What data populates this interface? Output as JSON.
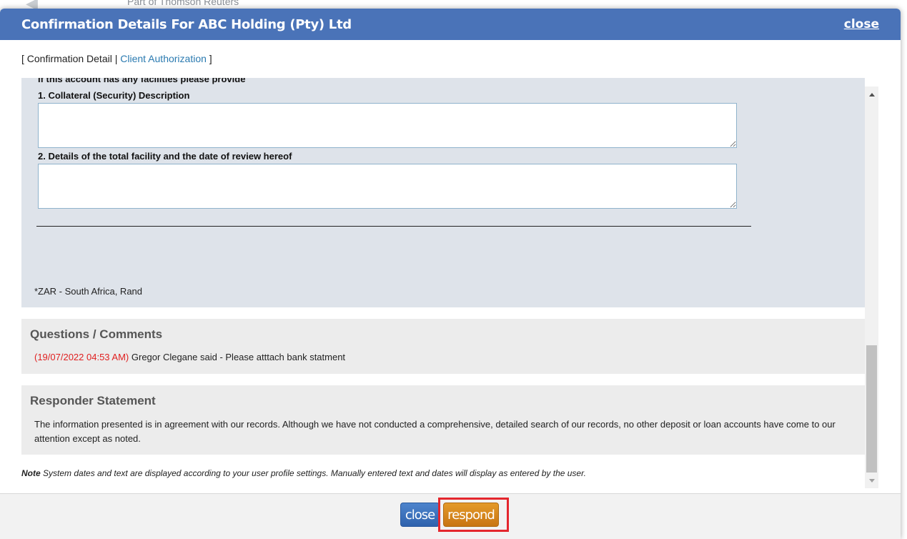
{
  "background": {
    "brand_text": "Part of Thomson Reuters"
  },
  "modal": {
    "title": "Confirmation Details For ABC Holding (Pty) Ltd",
    "header_close": "close"
  },
  "tabs": {
    "open_bracket": "[ ",
    "confirmation_detail": "Confirmation Detail",
    "separator": " | ",
    "client_authorization": "Client Authorization",
    "close_bracket": " ]"
  },
  "form": {
    "cut_off_text": "If this account has any facilities please provide",
    "q1_label": "1. Collateral (Security) Description",
    "q1_value": "",
    "q2_label": "2. Details of the total facility and the date of review hereof",
    "q2_value": "",
    "currency_note": "*ZAR - South Africa, Rand"
  },
  "questions_comments": {
    "title": "Questions / Comments",
    "comments": [
      {
        "date": "(19/07/2022 04:53 AM)",
        "text": " Gregor Clegane said - Please atttach bank statment"
      }
    ]
  },
  "responder_statement": {
    "title": "Responder Statement",
    "text": "The information presented is in agreement with our records. Although we have not conducted a comprehensive, detailed search of our records, no other deposit or loan accounts have come to our attention except as noted."
  },
  "note": {
    "label": "Note",
    "text": " System dates and text are displayed according to your user profile settings. Manually entered text and dates will display as entered by the user."
  },
  "footer": {
    "close_label": "close",
    "respond_label": "respond"
  },
  "colors": {
    "header": "#4a73b8",
    "link": "#2a7ab0",
    "comment_date": "#e02020",
    "close_button": "#3a6fbc",
    "respond_button": "#d8861c",
    "highlight": "#e4262d"
  }
}
